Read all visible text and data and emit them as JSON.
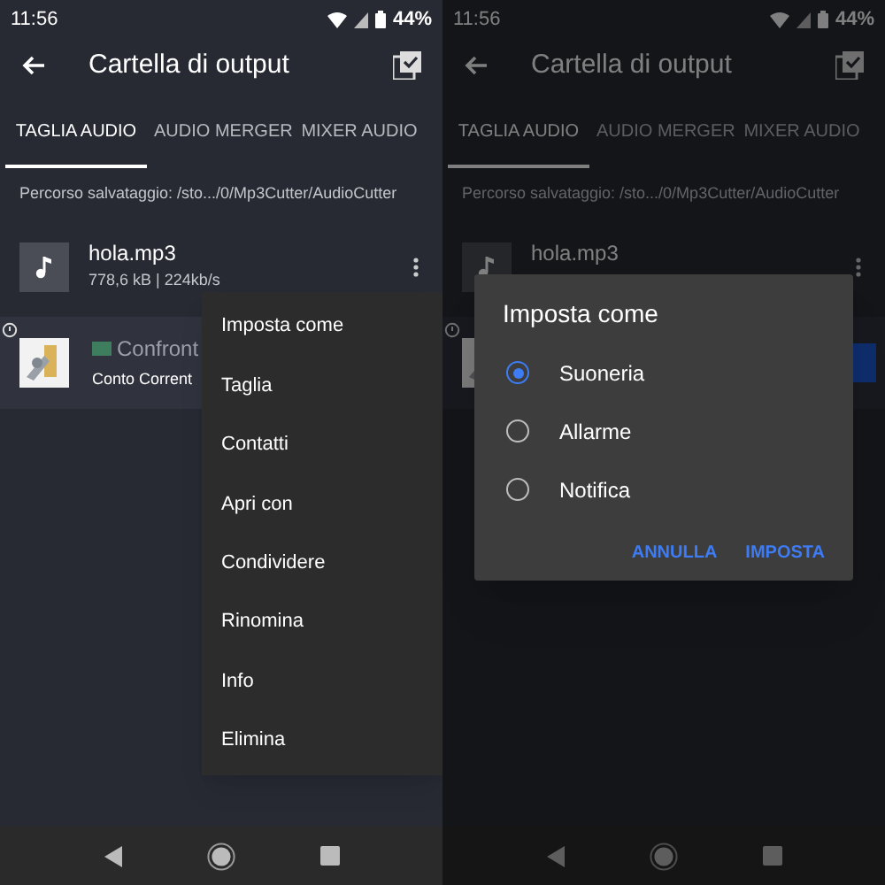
{
  "screens": [
    {
      "status_bar": {
        "time": "11:56",
        "battery": "44%"
      },
      "app_bar": {
        "title": "Cartella di output"
      },
      "tabs": [
        {
          "label": "TAGLIA AUDIO",
          "selected": true
        },
        {
          "label": "AUDIO MERGER",
          "selected": false
        },
        {
          "label": "MIXER AUDIO",
          "selected": false
        }
      ],
      "path": "Percorso salvataggio: /sto.../0/Mp3Cutter/AudioCutter",
      "file": {
        "name": "hola.mp3",
        "meta": "778,6 kB | 224kb/s"
      },
      "ad": {
        "title": "Confront",
        "subtitle": "Conto Corrent"
      },
      "menu": {
        "items": [
          "Imposta come",
          "Taglia",
          "Contatti",
          "Apri con",
          "Condividere",
          "Rinomina",
          "Info",
          "Elimina"
        ]
      }
    },
    {
      "status_bar": {
        "time": "11:56",
        "battery": "44%"
      },
      "app_bar": {
        "title": "Cartella di output"
      },
      "tabs": [
        {
          "label": "TAGLIA AUDIO",
          "selected": true
        },
        {
          "label": "AUDIO MERGER",
          "selected": false
        },
        {
          "label": "MIXER AUDIO",
          "selected": false
        }
      ],
      "path": "Percorso salvataggio: /sto.../0/Mp3Cutter/AudioCutter",
      "file": {
        "name": "hola.mp3"
      },
      "dialog": {
        "title": "Imposta come",
        "options": [
          {
            "label": "Suoneria",
            "selected": true
          },
          {
            "label": "Allarme",
            "selected": false
          },
          {
            "label": "Notifica",
            "selected": false
          }
        ],
        "buttons": [
          "ANNULLA",
          "IMPOSTA"
        ]
      }
    }
  ]
}
